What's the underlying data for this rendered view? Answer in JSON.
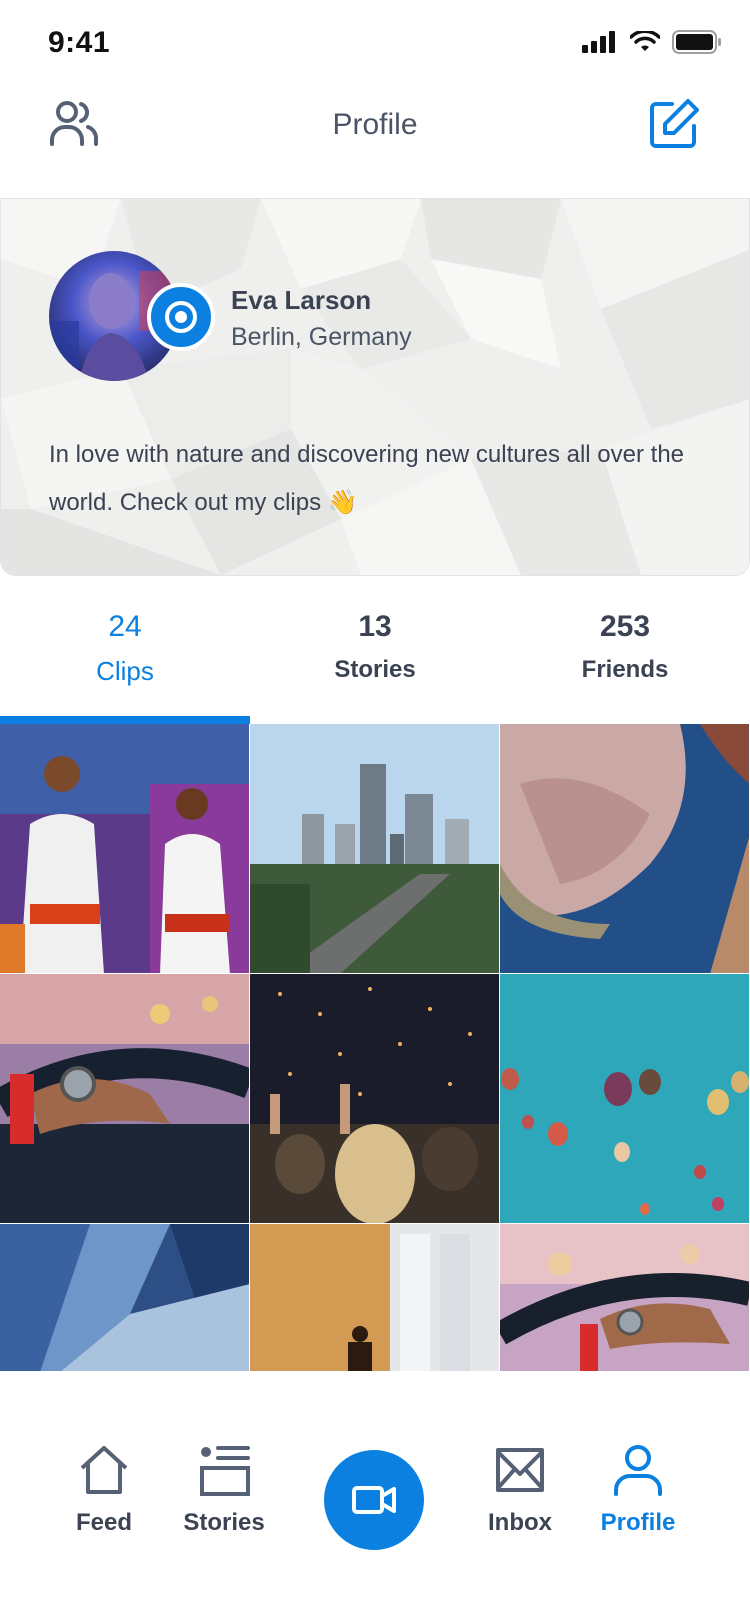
{
  "status": {
    "time": "9:41"
  },
  "nav": {
    "title": "Profile"
  },
  "profile": {
    "name": "Eva Larson",
    "location": "Berlin, Germany",
    "bio": "In love with nature and discovering new cultures all over the world. Check out my clips 👋"
  },
  "stats": [
    {
      "value": "24",
      "label": "Clips",
      "active": true
    },
    {
      "value": "13",
      "label": "Stories",
      "active": false
    },
    {
      "value": "253",
      "label": "Friends",
      "active": false
    }
  ],
  "grid": [
    {
      "subject": "dancers-photo"
    },
    {
      "subject": "city-skyline-photo"
    },
    {
      "subject": "canyon-river-aerial-photo"
    },
    {
      "subject": "driving-wheel-photo"
    },
    {
      "subject": "concert-crowd-photo"
    },
    {
      "subject": "hot-air-balloons-photo"
    },
    {
      "subject": "glass-building-photo"
    },
    {
      "subject": "hallway-silhouette-photo"
    },
    {
      "subject": "driving-sunset-photo"
    }
  ],
  "tabbar": {
    "feed": "Feed",
    "stories": "Stories",
    "inbox": "Inbox",
    "profile": "Profile"
  },
  "colors": {
    "accent": "#0b80e0",
    "text": "#3b4252"
  }
}
